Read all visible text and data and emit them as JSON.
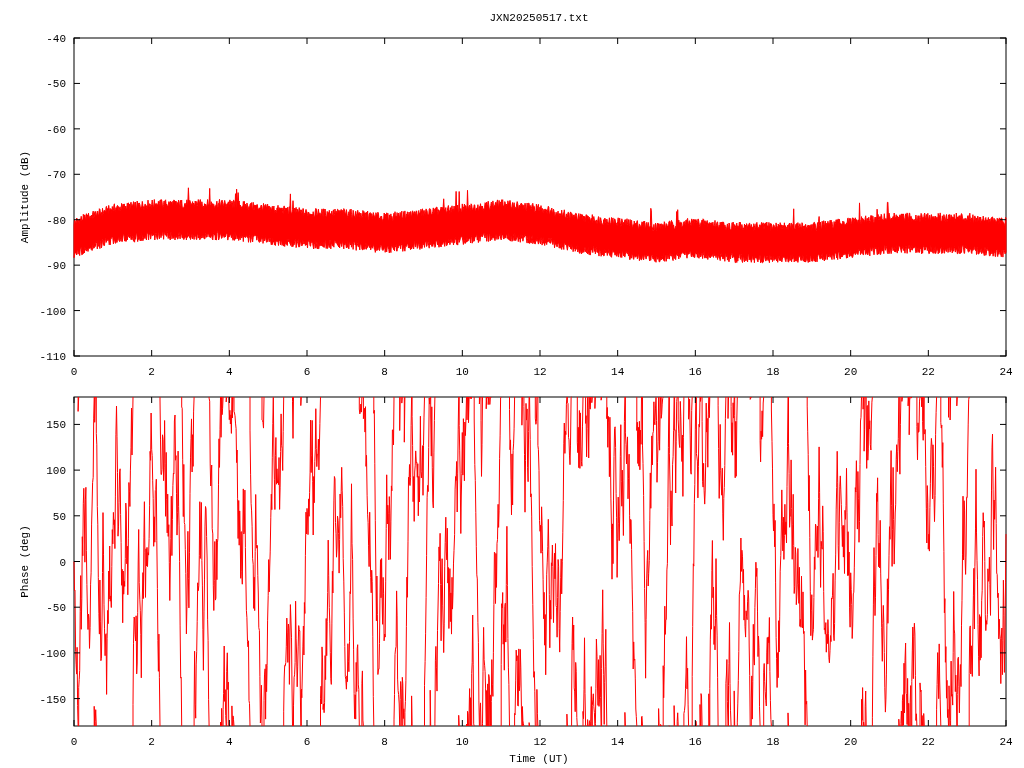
{
  "title": "JXN20250517.txt",
  "panels": [
    {
      "kind": "amplitude",
      "ylabel": "Amplitude (dB)",
      "yticks": [
        "-40",
        "-50",
        "-60",
        "-70",
        "-80",
        "-90",
        "-100",
        "-110"
      ],
      "xticks": [
        "0",
        "2",
        "4",
        "6",
        "8",
        "10",
        "12",
        "14",
        "16",
        "18",
        "20",
        "22",
        "24"
      ]
    },
    {
      "kind": "phase",
      "ylabel": "Phase (deg)",
      "yticks": [
        "150",
        "100",
        "50",
        "0",
        "-50",
        "-100",
        "-150"
      ],
      "xticks": [
        "0",
        "2",
        "4",
        "6",
        "8",
        "10",
        "12",
        "14",
        "16",
        "18",
        "20",
        "22",
        "24"
      ]
    }
  ],
  "xlabel": "Time (UT)"
}
